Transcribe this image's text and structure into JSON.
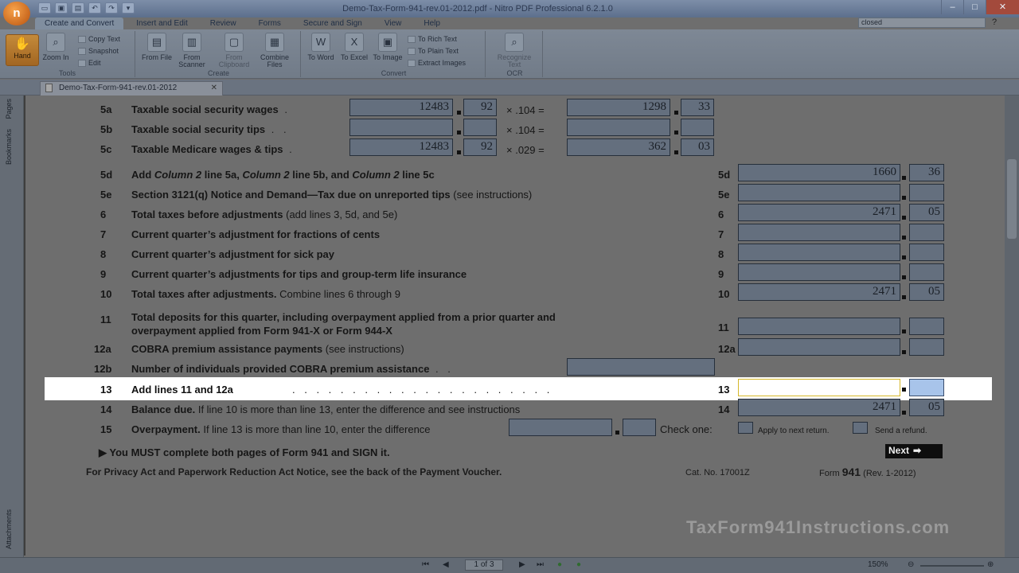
{
  "app": {
    "logo_letter": "n",
    "window_title": "Demo-Tax-Form-941-rev.01-2012.pdf - Nitro PDF Professional 6.2.1.0"
  },
  "window_controls": {
    "minimize": "–",
    "maximize": "□",
    "close": "✕"
  },
  "ribbon_tabs": [
    "Create and Convert",
    "Insert and Edit",
    "Review",
    "Forms",
    "Secure and Sign",
    "View",
    "Help"
  ],
  "search": {
    "value": "closed"
  },
  "ribbon": {
    "hand": "Hand",
    "zoom": "Zoom In",
    "copy_text": "Copy Text",
    "snapshot": "Snapshot",
    "edit": "Edit",
    "tools_label": "Tools",
    "from_file": "From File",
    "from_scanner": "From Scanner",
    "from_clipboard": "From Clipboard",
    "combine_files": "Combine Files",
    "create_label": "Create",
    "to_word": "To Word",
    "to_excel": "To Excel",
    "to_image": "To Image",
    "to_rich_text": "To Rich Text",
    "to_plain_text": "To Plain Text",
    "extract_images": "Extract Images",
    "convert_label": "Convert",
    "recognize_text": "Recognize Text",
    "ocr_label": "OCR"
  },
  "doc_tab": {
    "title": "Demo-Tax-Form-941-rev.01-2012",
    "close": "✕"
  },
  "left_pane": {
    "pages": "Pages",
    "bookmarks": "Bookmarks",
    "attachments": "Attachments"
  },
  "form": {
    "r5a": {
      "num": "5a",
      "label": "Taxable social security wages",
      "v1": "12483",
      "c1": "92",
      "mult": "× .104 =",
      "v2": "1298",
      "c2": "33"
    },
    "r5b": {
      "num": "5b",
      "label": "Taxable social security tips",
      "mult": "× .104 ="
    },
    "r5c": {
      "num": "5c",
      "label": "Taxable Medicare wages & tips",
      "v1": "12483",
      "c1": "92",
      "mult": "× .029 =",
      "v2": "362",
      "c2": "03"
    },
    "r5d": {
      "num": "5d",
      "label_a": "Add ",
      "col": "Column 2",
      "label_b": " line 5a, ",
      "label_c": " line 5b, and ",
      "label_d": " line 5c",
      "rnum": "5d",
      "value": "1660",
      "cents": "36"
    },
    "r5e": {
      "num": "5e",
      "label": "Section 3121(q) Notice and Demand—Tax due on unreported tips",
      "note": "(see instructions)",
      "rnum": "5e"
    },
    "r6": {
      "num": "6",
      "label": "Total taxes before adjustments",
      "note": "(add lines 3, 5d, and 5e)",
      "rnum": "6",
      "value": "2471",
      "cents": "05"
    },
    "r7": {
      "num": "7",
      "label": "Current quarter’s adjustment for fractions of cents",
      "rnum": "7"
    },
    "r8": {
      "num": "8",
      "label": "Current quarter’s adjustment for sick pay",
      "rnum": "8"
    },
    "r9": {
      "num": "9",
      "label": "Current quarter’s adjustments for tips and group-term life insurance",
      "rnum": "9"
    },
    "r10": {
      "num": "10",
      "label": "Total taxes after adjustments.",
      "note": "Combine lines 6 through 9",
      "rnum": "10",
      "value": "2471",
      "cents": "05"
    },
    "r11": {
      "num": "11",
      "label1": "Total deposits for this quarter, including overpayment applied from a prior quarter and",
      "label2": "overpayment applied from Form 941-X or Form 944-X",
      "rnum": "11"
    },
    "r12a": {
      "num": "12a",
      "label": "COBRA premium assistance payments",
      "note": "(see instructions)",
      "rnum": "12a"
    },
    "r12b": {
      "num": "12b",
      "label": "Number of individuals provided COBRA premium assistance"
    },
    "r13": {
      "num": "13",
      "label": "Add lines 11 and 12a",
      "rnum": "13"
    },
    "r14": {
      "num": "14",
      "label": "Balance due.",
      "note": "If line 10 is more than line 13, enter the difference and see instructions",
      "rnum": "14",
      "value": "2471",
      "cents": "05"
    },
    "r15": {
      "num": "15",
      "label": "Overpayment.",
      "note": "If line 13 is more than line 10, enter the difference",
      "check_one": "Check one:",
      "opt1": "Apply to next return.",
      "opt2": "Send a refund."
    },
    "must": "You MUST complete both pages of Form 941 and SIGN it.",
    "next": "Next",
    "privacy": "For Privacy Act and Paperwork Reduction Act Notice, see the back of the Payment Voucher.",
    "cat": "Cat. No. 17001Z",
    "form_word": "Form",
    "form_num": "941",
    "rev": "(Rev. 1-2012)",
    "dots": ". . . . . . . . . . . . . . . . . . . . . ."
  },
  "watermark": "TaxForm941Instructions.com",
  "status": {
    "page": "1 of 3",
    "zoom": "150%"
  }
}
